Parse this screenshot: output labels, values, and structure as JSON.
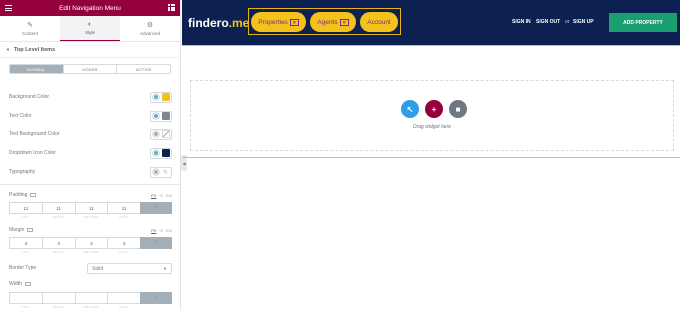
{
  "panel": {
    "title": "Edit Navigation Menu",
    "tabs": [
      {
        "label": "Content",
        "icon": "pencil-icon"
      },
      {
        "label": "Style",
        "icon": "half-circle-icon"
      },
      {
        "label": "Advanced",
        "icon": "gear-icon"
      }
    ],
    "section_title": "Top Level Items",
    "state_tabs": [
      "NORMAL",
      "HOVER",
      "ACTIVE"
    ],
    "controls": [
      {
        "label": "Background Color",
        "swatch": "#f5c21b"
      },
      {
        "label": "Text Color",
        "swatch": "#7f8790"
      },
      {
        "label": "Text Background Color",
        "swatch": "none"
      },
      {
        "label": "Dropdown Icon Color",
        "swatch": "#0c2151"
      },
      {
        "label": "Typography"
      }
    ],
    "padding": {
      "label": "Padding",
      "unit_px": "PX",
      "unit_pct": "%",
      "unit_em": "EM",
      "values": [
        "11",
        "11",
        "11",
        "11"
      ],
      "sub": [
        "TOP",
        "RIGHT",
        "BOTTOM",
        "LEFT"
      ]
    },
    "margin": {
      "label": "Margin",
      "unit_px": "PX",
      "unit_pct": "%",
      "unit_em": "EM",
      "values": [
        "3",
        "3",
        "3",
        "3"
      ],
      "sub": [
        "TOP",
        "RIGHT",
        "BOTTOM",
        "LEFT"
      ]
    },
    "border_type": {
      "label": "Border Type",
      "value": "Solid"
    },
    "width": {
      "label": "Width",
      "values": [
        "",
        "",
        "",
        ""
      ],
      "sub": [
        "TOP",
        "RIGHT",
        "BOTTOM",
        "LEFT"
      ]
    }
  },
  "site": {
    "logo_main": "findero",
    "logo_accent": ".me",
    "menu": [
      {
        "label": "Properties",
        "icon": "properties-menu-icon"
      },
      {
        "label": "Agents",
        "icon": "agents-menu-icon"
      },
      {
        "label": "Account"
      }
    ],
    "sign_in": "SIGN IN",
    "sign_out": "SIGN OUT",
    "or": "or",
    "sign_up": "SIGN UP",
    "add_property": "ADD PROPERTY"
  },
  "canvas": {
    "drag_text": "Drag widget here",
    "buttons": [
      {
        "name": "arrow-icon",
        "color": "#2f9ee6"
      },
      {
        "name": "plus-icon",
        "color": "#93003c"
      },
      {
        "name": "folder-icon",
        "color": "#6d7882"
      }
    ]
  },
  "colors": {
    "header": "#0c2151",
    "accent_yellow": "#f5c21b",
    "panel_accent": "#93003c",
    "add_button": "#1aa070"
  }
}
